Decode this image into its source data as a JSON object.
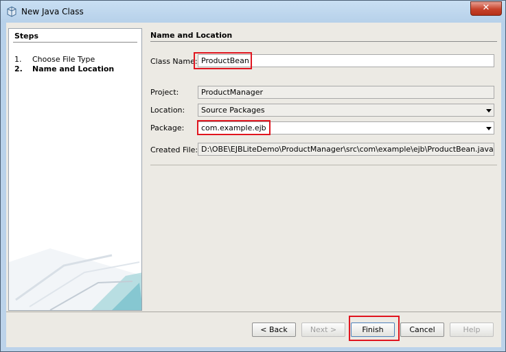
{
  "window": {
    "title": "New Java Class",
    "close_glyph": "✕"
  },
  "steps": {
    "header": "Steps",
    "items": [
      {
        "num": "1.",
        "label": "Choose File Type",
        "current": false
      },
      {
        "num": "2.",
        "label": "Name and Location",
        "current": true
      }
    ]
  },
  "panel": {
    "header": "Name and Location",
    "class_name": {
      "label": "Class Name:",
      "value": "ProductBean"
    },
    "project": {
      "label": "Project:",
      "value": "ProductManager"
    },
    "location": {
      "label": "Location:",
      "value": "Source Packages"
    },
    "package": {
      "label": "Package:",
      "value": "com.example.ejb"
    },
    "created_file": {
      "label": "Created File:",
      "value": "D:\\OBE\\EJBLiteDemo\\ProductManager\\src\\com\\example\\ejb\\ProductBean.java"
    }
  },
  "buttons": {
    "back": "< Back",
    "next": "Next >",
    "finish": "Finish",
    "cancel": "Cancel",
    "help": "Help"
  },
  "colors": {
    "highlight": "#e0141e",
    "title_bar": "#bcd3ea",
    "close_button": "#c7432b"
  }
}
